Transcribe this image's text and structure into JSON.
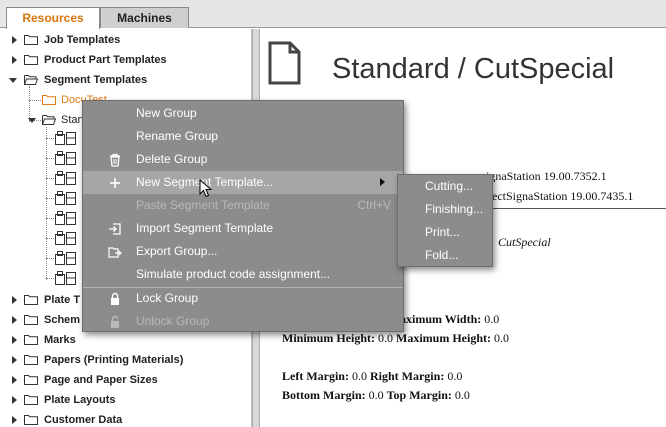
{
  "tabs": [
    {
      "label": "Resources",
      "active": true
    },
    {
      "label": "Machines",
      "active": false
    }
  ],
  "tree": {
    "job_templates": "Job Templates",
    "product_part_templates": "Product Part Templates",
    "segment_templates": "Segment Templates",
    "docu_test": "DocuTest",
    "standard_partial": "Stan",
    "plate_templates_partial": "Plate T",
    "schemes_partial": "Schem",
    "marks": "Marks",
    "papers": "Papers (Printing Materials)",
    "page_paper_sizes": "Page and Paper Sizes",
    "plate_layouts": "Plate Layouts",
    "customer_data": "Customer Data"
  },
  "detail": {
    "title": "Standard / CutSpecial",
    "version_1": "ignaStation 19.00.7352.1",
    "version_2": "nectSignaStation 19.00.7435.1",
    "name_value": "CutSpecial",
    "max_width_label": "aximum Width:",
    "max_width_value": "0.0",
    "min_height_label": "Minimum Height:",
    "min_height_value": "0.0",
    "max_height_label": "Maximum Height:",
    "max_height_value": "0.0",
    "left_margin_label": "Left Margin:",
    "left_margin_value": "0.0",
    "right_margin_label": "Right Margin:",
    "right_margin_value": "0.0",
    "bottom_margin_label": "Bottom Margin:",
    "bottom_margin_value": "0.0",
    "top_margin_label": "Top Margin:",
    "top_margin_value": "0.0"
  },
  "context_menu": {
    "items": [
      {
        "label": "New Group",
        "icon": "",
        "enabled": true
      },
      {
        "label": "Rename Group",
        "icon": "",
        "enabled": true
      },
      {
        "label": "Delete Group",
        "icon": "trash-icon",
        "enabled": true
      },
      {
        "label": "New Segment Template...",
        "icon": "plus-icon",
        "enabled": true,
        "submenu": true
      },
      {
        "label": "Paste Segment Template",
        "icon": "",
        "enabled": false,
        "shortcut": "Ctrl+V"
      },
      {
        "label": "Import Segment Template",
        "icon": "import-icon",
        "enabled": true
      },
      {
        "label": "Export Group...",
        "icon": "export-icon",
        "enabled": true
      },
      {
        "label": "Simulate product code assignment...",
        "icon": "",
        "enabled": true
      },
      {
        "label": "Lock Group",
        "icon": "lock-icon",
        "enabled": true
      },
      {
        "label": "Unlock Group",
        "icon": "unlock-icon",
        "enabled": false
      }
    ]
  },
  "submenu": {
    "items": [
      "Cutting...",
      "Finishing...",
      "Print...",
      "Fold..."
    ]
  },
  "colors": {
    "active_tab_text": "#d8750f",
    "tree_highlight": "#e07c18",
    "menu_bg": "#8c8c8c",
    "menu_hover": "#a6a6a6"
  }
}
